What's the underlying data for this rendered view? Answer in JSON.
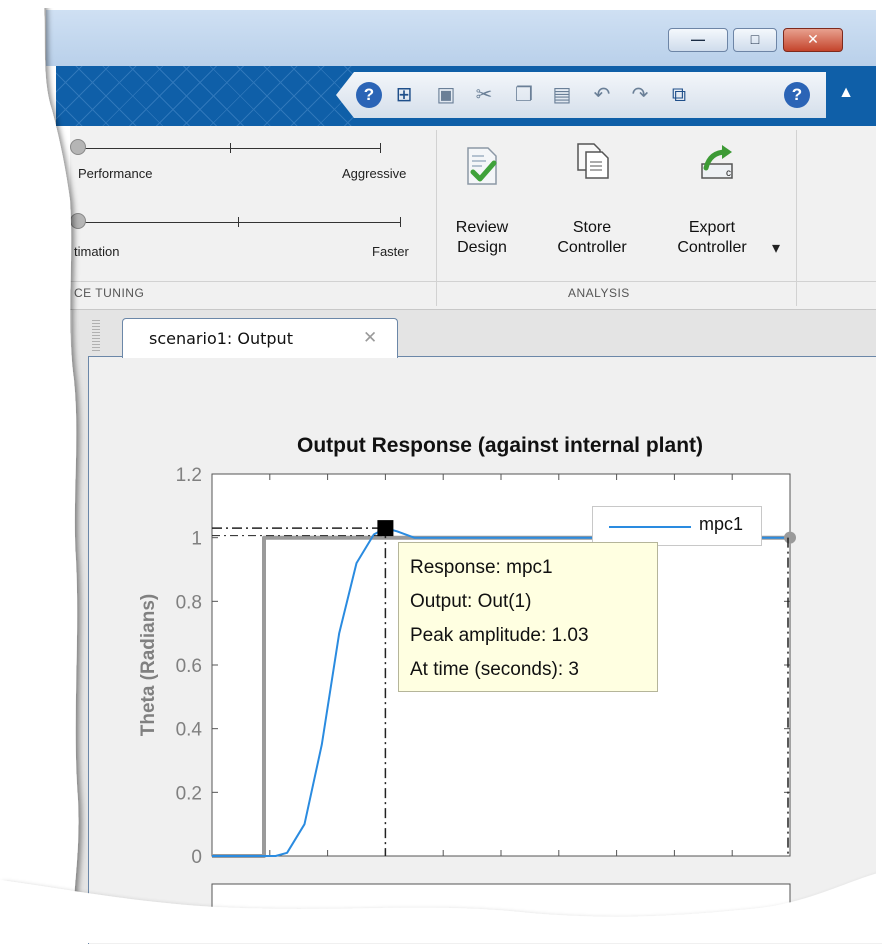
{
  "window_controls": {
    "minimize": "—",
    "maximize": "□",
    "close": "✕"
  },
  "quick_access": {
    "icons": [
      "help-icon",
      "new-session-icon",
      "save-icon",
      "cut-icon",
      "copy-icon",
      "paste-icon",
      "undo-icon",
      "redo-icon",
      "restore-icon",
      "help-icon",
      "collapse-icon"
    ]
  },
  "ribbon": {
    "slider1": {
      "left_label": "Performance",
      "right_label": "Aggressive"
    },
    "slider2": {
      "left_label": "timation",
      "right_label": "Faster"
    },
    "section_tuning": "CE TUNING",
    "section_analysis": "ANALYSIS",
    "review": {
      "line1": "Review",
      "line2": "Design"
    },
    "store": {
      "line1": "Store",
      "line2": "Controller"
    },
    "export": {
      "line1": "Export",
      "line2": "Controller"
    },
    "export_dropdown": "▾"
  },
  "tab": {
    "label": "scenario1: Output",
    "close": "✕"
  },
  "chart_data": {
    "type": "line",
    "title": "Output Response (against internal plant)",
    "xlabel": "",
    "ylabel": "Theta (Radians)",
    "ylim": [
      0,
      1.2
    ],
    "yticks": [
      "0",
      "0.2",
      "0.4",
      "0.6",
      "0.8",
      "1",
      "1.2"
    ],
    "grid": false,
    "legend": "top-right",
    "series": [
      {
        "name": "mpc1",
        "color": "#2a8be0",
        "x": [
          0,
          1.1,
          1.3,
          1.6,
          1.9,
          2.2,
          2.5,
          2.8,
          3.0,
          3.2,
          3.5,
          4.0,
          5.0,
          6.0,
          7.0,
          8.0,
          9.0,
          10.0
        ],
        "values": [
          0,
          0,
          0.01,
          0.1,
          0.35,
          0.7,
          0.92,
          1.01,
          1.03,
          1.02,
          1.0,
          1.0,
          1.0,
          1.0,
          1.0,
          1.0,
          1.0,
          1.0
        ]
      },
      {
        "name": "",
        "color": "#9a9a9a",
        "x": [
          0,
          0.9,
          0.9,
          10.0
        ],
        "values": [
          0,
          0,
          1.0,
          1.0
        ]
      }
    ],
    "xlim": [
      0,
      10
    ],
    "peak": {
      "x": 3,
      "y": 1.03
    },
    "datatip": {
      "line1": "Response: mpc1",
      "line2": "Output: Out(1)",
      "line3": "Peak amplitude: 1.03",
      "line4": "At time (seconds): 3"
    }
  },
  "colors": {
    "toolstrip_blue": "#0f5fa8",
    "series_blue": "#2a8be0",
    "reference_gray": "#9a9a9a",
    "datatip_bg": "#ffffe1"
  }
}
